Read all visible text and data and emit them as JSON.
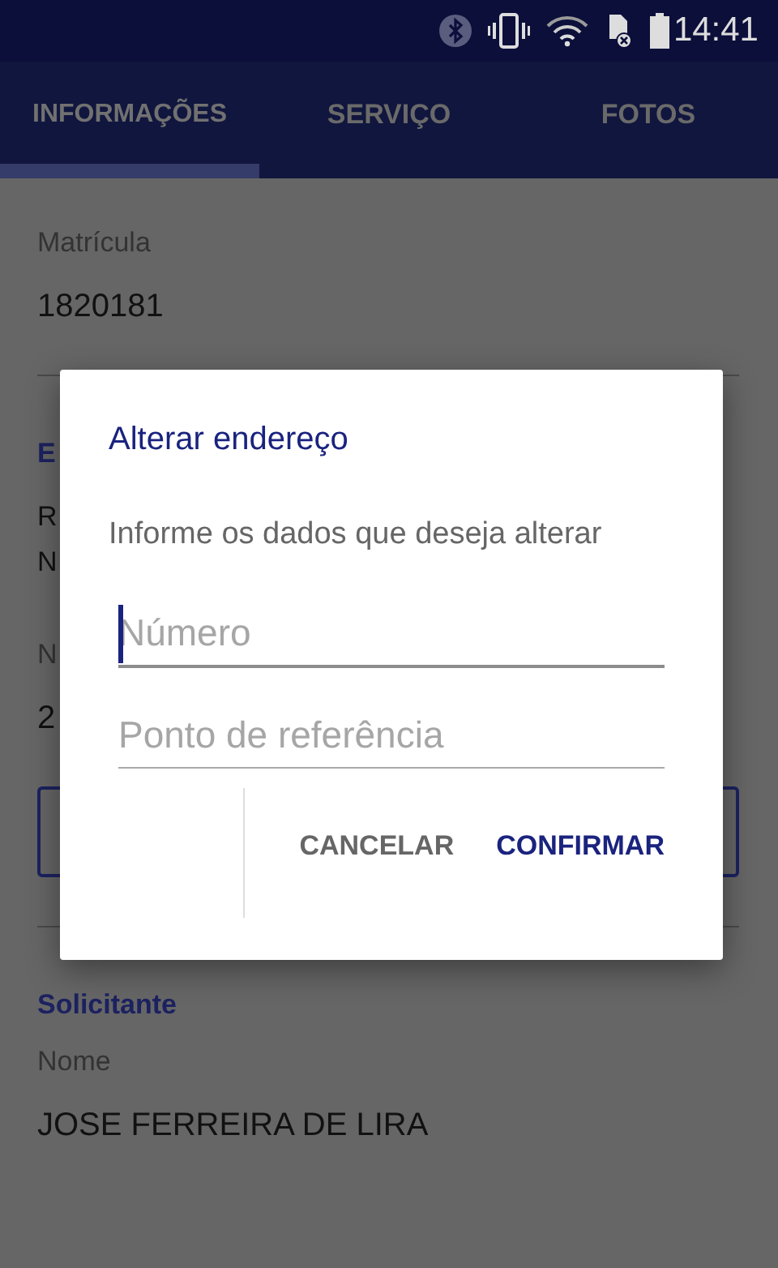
{
  "status_bar": {
    "time": "14:41"
  },
  "tabs": [
    {
      "label": "INFORMAÇÕES",
      "selected": true
    },
    {
      "label": "SERVIÇO",
      "selected": false
    },
    {
      "label": "FOTOS",
      "selected": false
    }
  ],
  "content": [
    {
      "kind": "field",
      "label": "Matrícula",
      "value": "1820181"
    },
    {
      "kind": "divider"
    },
    {
      "kind": "section",
      "title": "E"
    },
    {
      "kind": "lines",
      "lines": [
        "R",
        "N"
      ]
    },
    {
      "kind": "field",
      "label": "N",
      "value": "2"
    },
    {
      "kind": "outlined-button"
    },
    {
      "kind": "divider"
    },
    {
      "kind": "section",
      "title": "Solicitante"
    },
    {
      "kind": "field",
      "label": "Nome",
      "value": "JOSE FERREIRA DE LIRA"
    }
  ],
  "dialog": {
    "title": "Alterar endereço",
    "message": "Informe os dados que deseja alterar",
    "fields": [
      {
        "placeholder": "Número",
        "focused": true
      },
      {
        "placeholder": "Ponto de referência",
        "focused": false
      }
    ],
    "buttons": [
      {
        "label": "CANCELAR",
        "primary": false
      },
      {
        "label": "CONFIRMAR",
        "primary": true
      }
    ]
  }
}
